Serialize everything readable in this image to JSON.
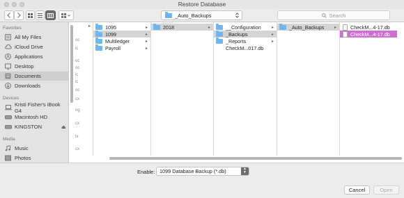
{
  "window": {
    "title": "Restore Database"
  },
  "toolbar": {
    "back_icon": "chevron-left-icon",
    "forward_icon": "chevron-right-icon",
    "path_folder": "_Auto_Backups",
    "search_placeholder": "Search"
  },
  "sidebar": {
    "sections": [
      {
        "label": "Favorites",
        "items": [
          {
            "label": "All My Files",
            "icon": "all-files-icon"
          },
          {
            "label": "iCloud Drive",
            "icon": "cloud-icon"
          },
          {
            "label": "Applications",
            "icon": "applications-icon"
          },
          {
            "label": "Desktop",
            "icon": "desktop-icon"
          },
          {
            "label": "Documents",
            "icon": "documents-icon",
            "selected": true
          },
          {
            "label": "Downloads",
            "icon": "downloads-icon"
          }
        ]
      },
      {
        "label": "Devices",
        "items": [
          {
            "label": "Kristi Fisher's iBook G4",
            "icon": "laptop-icon"
          },
          {
            "label": "Macintosh HD",
            "icon": "harddrive-icon"
          },
          {
            "label": "KINGSTON",
            "icon": "harddrive-icon",
            "eject": "⏏"
          }
        ]
      },
      {
        "label": "Media",
        "items": [
          {
            "label": "Music",
            "icon": "music-icon"
          },
          {
            "label": "Photos",
            "icon": "photos-icon"
          }
        ]
      }
    ]
  },
  "columns": {
    "col0_fragments": [
      "oc",
      "ic",
      "oc",
      "oc",
      "ic",
      "ic",
      "oc",
      "cx",
      "ng",
      "cx",
      "tx",
      "cx"
    ],
    "col1": [
      {
        "label": "1095",
        "type": "folder"
      },
      {
        "label": "1099",
        "type": "folder",
        "selected": true
      },
      {
        "label": "Multiledger",
        "type": "folder"
      },
      {
        "label": "Payroll",
        "type": "folder"
      }
    ],
    "col2": [
      {
        "label": "2018",
        "type": "folder",
        "selected": true
      }
    ],
    "col3": [
      {
        "label": "__Configuration",
        "type": "folder"
      },
      {
        "label": "_Backups",
        "type": "folder",
        "selected": true
      },
      {
        "label": "_Reports",
        "type": "folder"
      },
      {
        "label": "CheckM...017.db",
        "type": "file"
      }
    ],
    "col4": [
      {
        "label": "_Auto_Backups",
        "type": "folder",
        "selected": true
      }
    ],
    "col5": [
      {
        "label": "CheckM...4-17.db",
        "type": "file"
      },
      {
        "label": "CheckM...4-17.db",
        "type": "file",
        "selected": true
      }
    ]
  },
  "footer": {
    "enable_label": "Enable:",
    "enable_value": "1099 Database Backup (*.db)",
    "cancel_label": "Cancel",
    "open_label": "Open"
  },
  "colors": {
    "selection_pink": "#cf6fd2",
    "folder_blue": "#6fb6ef"
  }
}
